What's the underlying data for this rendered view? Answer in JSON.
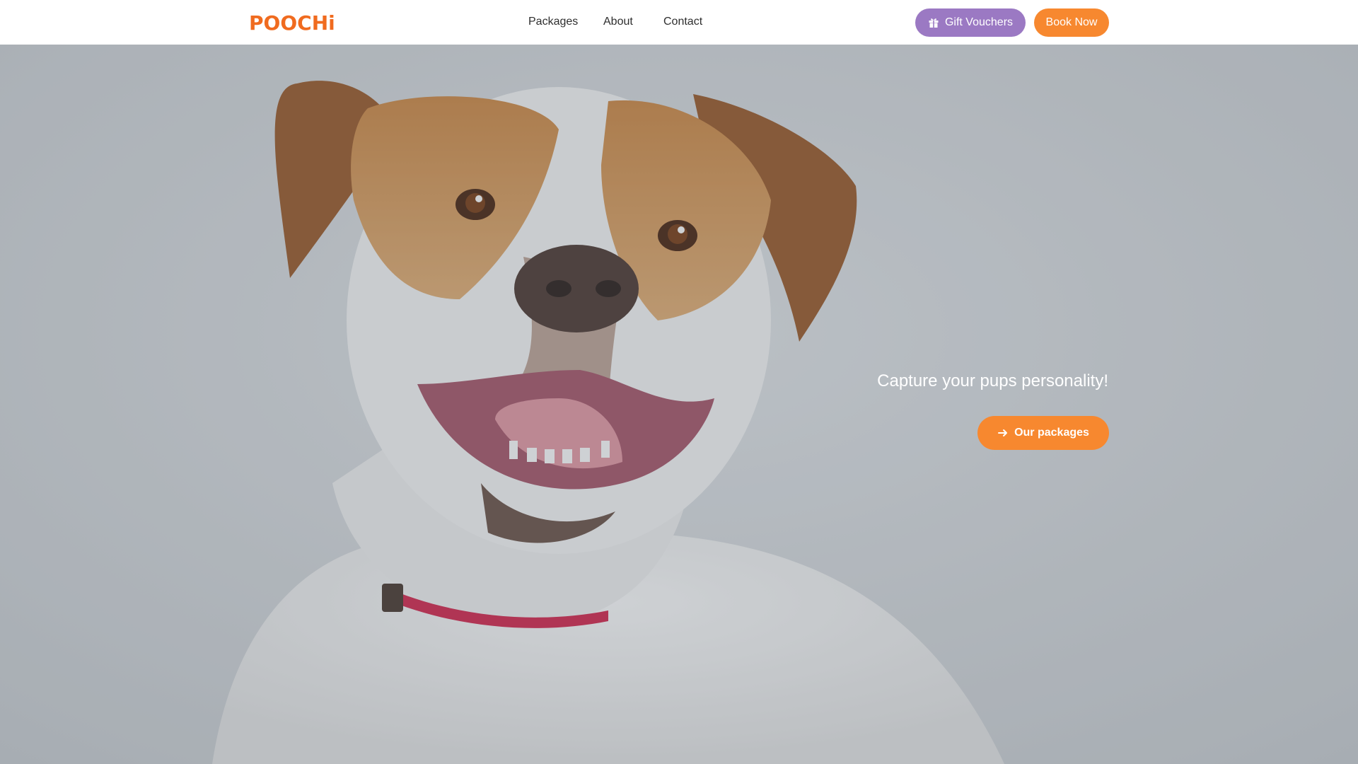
{
  "brand": {
    "letters": [
      "P",
      "O",
      "O",
      "C",
      "H",
      "i"
    ],
    "colors": {
      "logo_orange": "#f06b1f",
      "accent_orange": "#f7882f",
      "accent_purple": "#9b79c3",
      "nav_text": "#2e2e2e"
    }
  },
  "nav": {
    "links": [
      {
        "label": "Packages"
      },
      {
        "label": "About"
      },
      {
        "label": "Contact"
      }
    ],
    "gift_label": "Gift Vouchers",
    "gift_icon": "gift-icon",
    "book_label": "Book Now"
  },
  "hero": {
    "tagline": "Capture your pups personality!",
    "cta_label": "Our packages",
    "cta_icon": "arrow-right-icon",
    "image": "smiling white and tan dog with red collar"
  }
}
